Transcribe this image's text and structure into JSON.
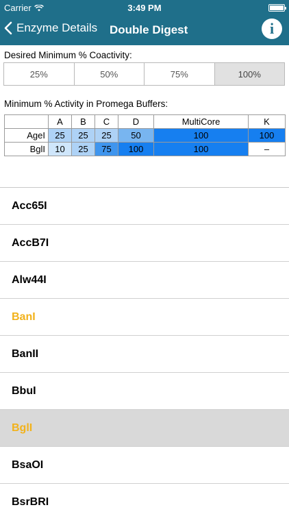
{
  "status_bar": {
    "carrier": "Carrier",
    "time": "3:49 PM"
  },
  "nav": {
    "back_label": "Enzyme Details",
    "title": "Double Digest",
    "info_glyph": "i"
  },
  "coactivity": {
    "label": "Desired Minimum % Coactivity:",
    "options": [
      "25%",
      "50%",
      "75%",
      "100%"
    ],
    "selected": "100%"
  },
  "activity": {
    "label": "Minimum % Activity in Promega Buffers:",
    "headers": [
      "",
      "A",
      "B",
      "C",
      "D",
      "MultiCore",
      "K"
    ],
    "rows": [
      {
        "enzyme": "AgeI",
        "values": [
          "25",
          "25",
          "25",
          "50",
          "100",
          "100"
        ]
      },
      {
        "enzyme": "BglI",
        "values": [
          "10",
          "25",
          "75",
          "100",
          "100",
          "–"
        ]
      }
    ]
  },
  "enzymes": [
    {
      "name": "Acc65I",
      "highlight": false,
      "selected": false
    },
    {
      "name": "AccB7I",
      "highlight": false,
      "selected": false
    },
    {
      "name": "Alw44I",
      "highlight": false,
      "selected": false
    },
    {
      "name": "BanI",
      "highlight": true,
      "selected": false
    },
    {
      "name": "BanII",
      "highlight": false,
      "selected": false
    },
    {
      "name": "BbuI",
      "highlight": false,
      "selected": false
    },
    {
      "name": "BglI",
      "highlight": true,
      "selected": true
    },
    {
      "name": "BsaOI",
      "highlight": false,
      "selected": false
    },
    {
      "name": "BsrBRI",
      "highlight": false,
      "selected": false
    }
  ],
  "colors": {
    "nav_background": "#1f6f8a",
    "highlight_text": "#f2b21b",
    "activity_100": "#167ff0",
    "activity_75": "#3f95ee",
    "activity_50": "#78b5f0",
    "activity_25": "#aed2f6",
    "activity_10": "#cfe6fb"
  }
}
